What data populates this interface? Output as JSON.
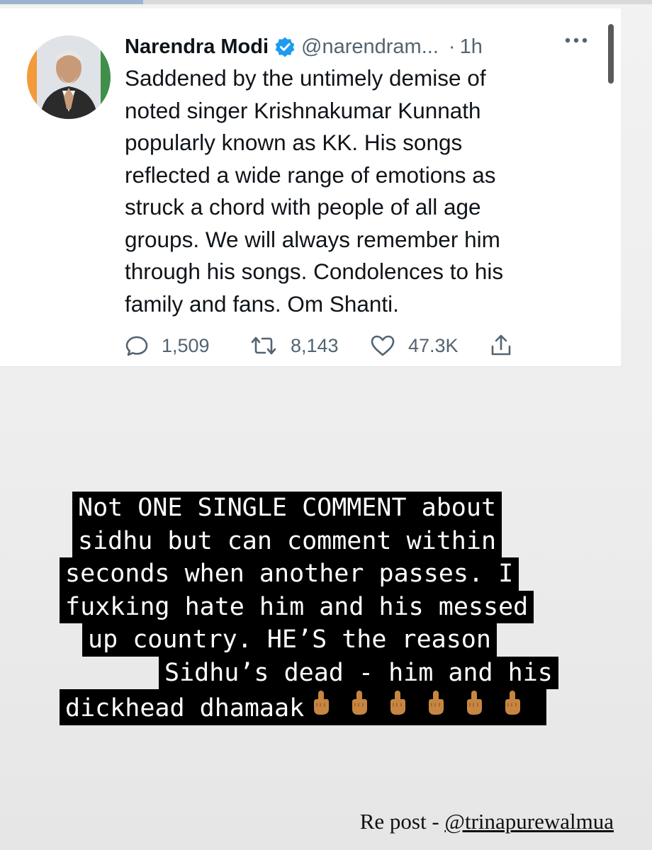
{
  "story": {
    "progress": 0.22,
    "progress_color": "#9bb3cf"
  },
  "tweet": {
    "author_name": "Narendra Modi",
    "handle": "@narendram...",
    "separator": "·",
    "time": "1h",
    "verified": true,
    "verified_color": "#1d9bf0",
    "text_lines": [
      "Saddened by the untimely demise of",
      "noted singer Krishnakumar Kunnath",
      "popularly known as KK. His songs",
      "reflected a wide range of emotions as",
      "struck a chord with people of all age",
      "groups. We will always remember him",
      "through his songs. Condolences to his",
      "family and fans. Om Shanti."
    ],
    "replies": "1,509",
    "retweets": "8,143",
    "likes": "47.3K",
    "icons": [
      "reply-icon",
      "retweet-icon",
      "like-icon",
      "share-icon",
      "more-icon"
    ]
  },
  "caption": {
    "lines": [
      "Not ONE SINGLE COMMENT about",
      "sidhu but can comment within",
      "seconds when another passes. I",
      "fuxking hate him and his messed",
      "up country. HE’S the reason",
      "Sidhu’s dead - him and his",
      "dickhead dhamaak"
    ],
    "emoji": "middle-finger-emoji",
    "emoji_count": 6
  },
  "repost": {
    "prefix": "Re post - ",
    "handle": "@trinapurewalmua"
  }
}
